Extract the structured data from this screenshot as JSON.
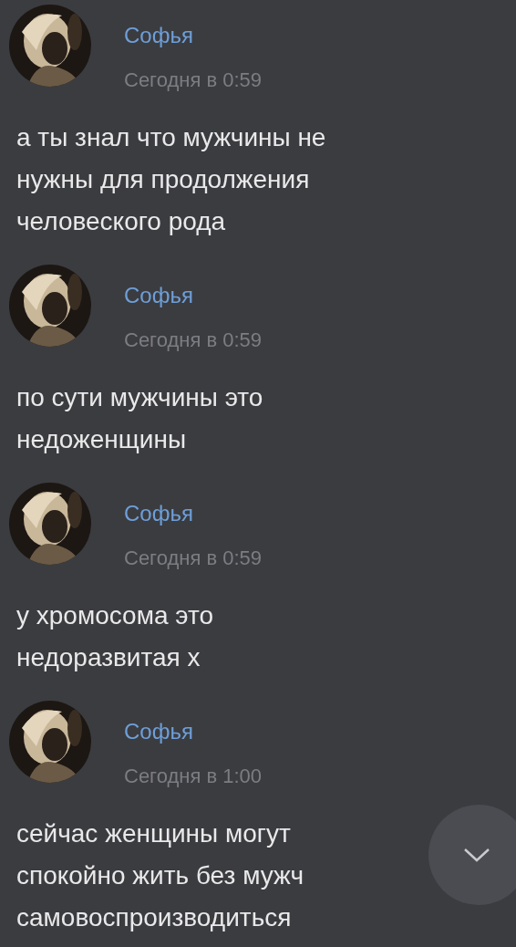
{
  "messages": [
    {
      "author": "Софья",
      "time": "Сегодня в 0:59",
      "lines": [
        "а ты знал что мужчины не",
        "нужны для продолжения",
        "человеского рода"
      ]
    },
    {
      "author": "Софья",
      "time": "Сегодня в 0:59",
      "lines": [
        "по сути мужчины это",
        "недоженщины"
      ]
    },
    {
      "author": "Софья",
      "time": "Сегодня в 0:59",
      "lines": [
        "у хромосома это",
        "недоразвитая х"
      ]
    },
    {
      "author": "Софья",
      "time": "Сегодня в 1:00",
      "lines": [
        "сейчас женщины могут",
        "спокойно жить без мужч",
        "самовоспроизводиться"
      ]
    }
  ]
}
